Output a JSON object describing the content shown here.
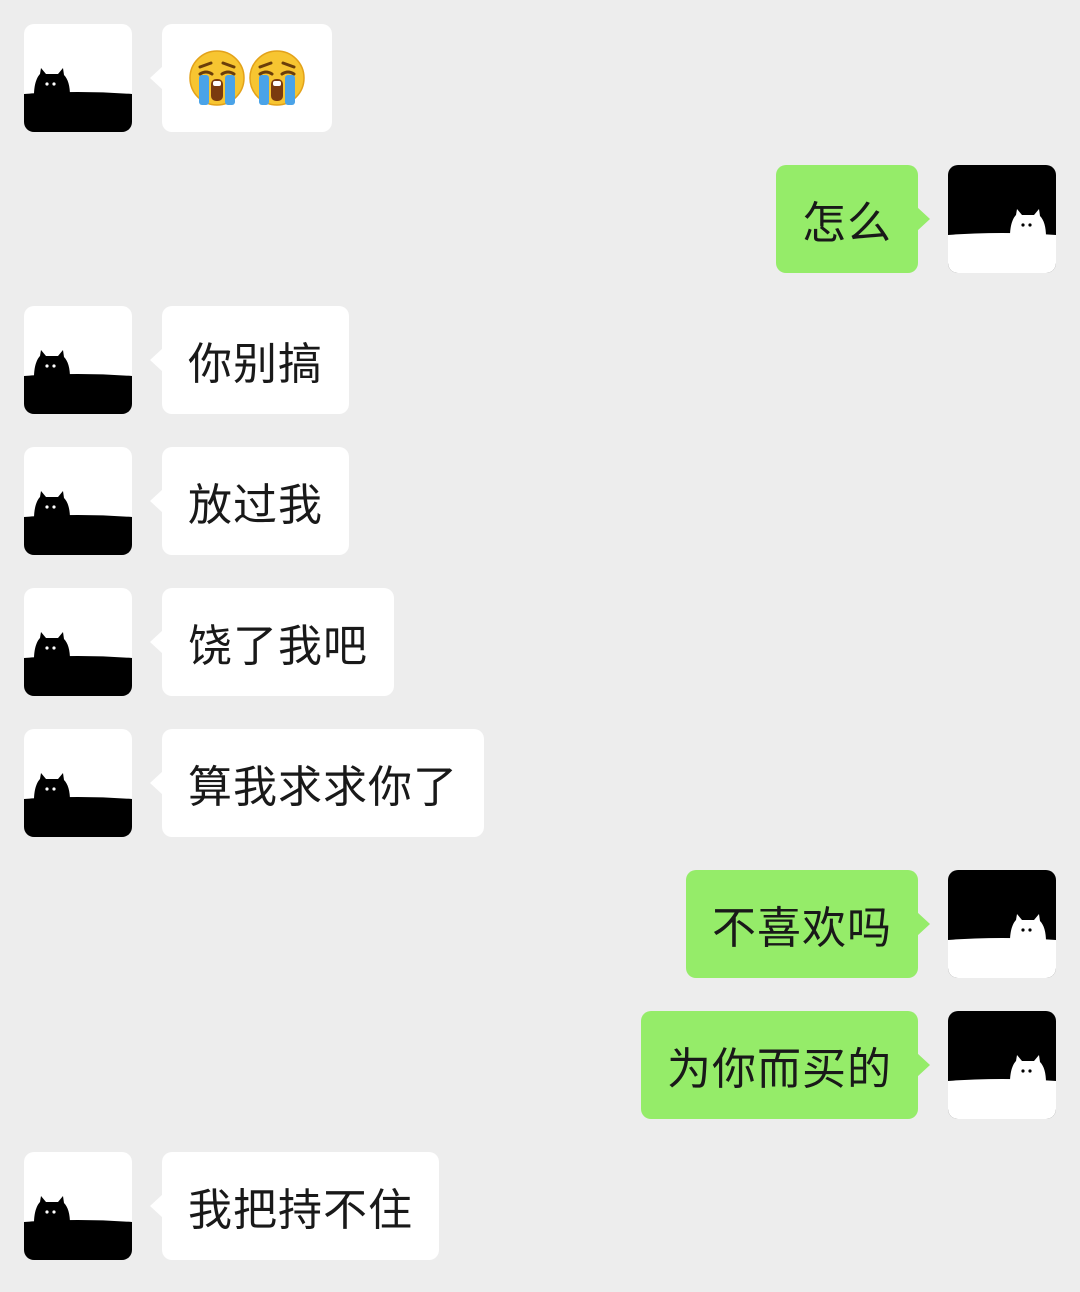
{
  "chat": {
    "messages": [
      {
        "side": "left",
        "type": "emoji",
        "emojis": [
          "loudly-crying-face",
          "loudly-crying-face"
        ]
      },
      {
        "side": "right",
        "type": "text",
        "text": "怎么"
      },
      {
        "side": "left",
        "type": "text",
        "text": "你别搞"
      },
      {
        "side": "left",
        "type": "text",
        "text": "放过我"
      },
      {
        "side": "left",
        "type": "text",
        "text": "饶了我吧"
      },
      {
        "side": "left",
        "type": "text",
        "text": "算我求求你了"
      },
      {
        "side": "right",
        "type": "text",
        "text": "不喜欢吗"
      },
      {
        "side": "right",
        "type": "text",
        "text": "为你而买的"
      },
      {
        "side": "left",
        "type": "text",
        "text": "我把持不住"
      }
    ]
  },
  "colors": {
    "background": "#ededed",
    "incoming_bubble": "#ffffff",
    "outgoing_bubble": "#95ec69",
    "text": "#191919"
  }
}
